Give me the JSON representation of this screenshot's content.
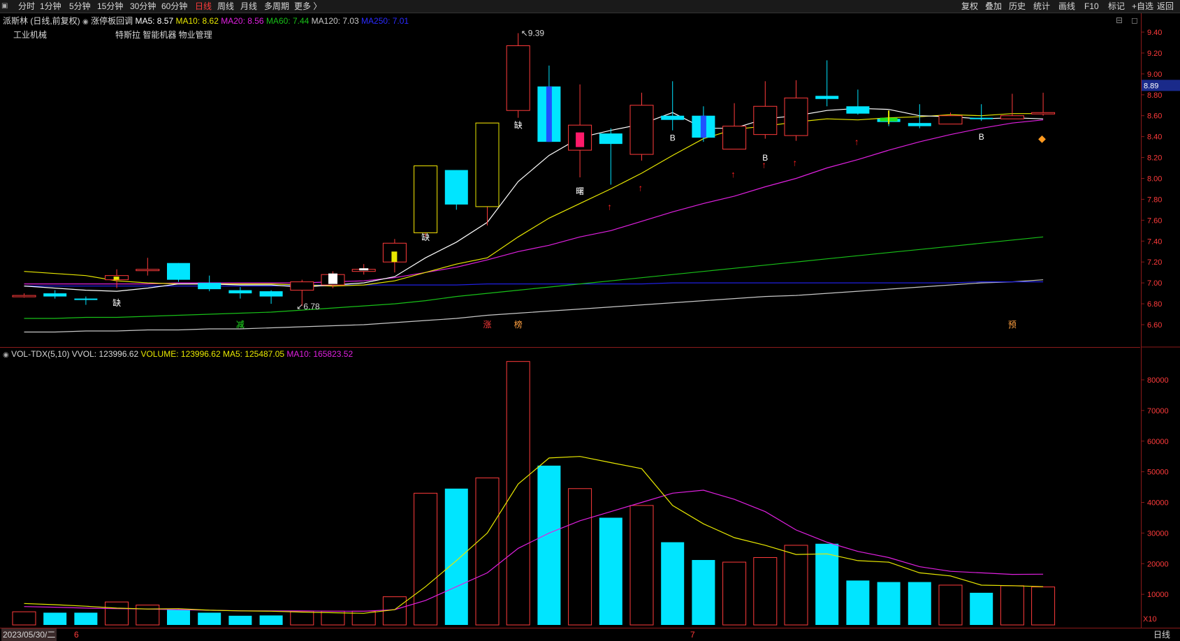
{
  "toolbar": {
    "periods": [
      "分时",
      "1分钟",
      "5分钟",
      "15分钟",
      "30分钟",
      "60分钟",
      "日线",
      "周线",
      "月线",
      "多周期",
      "更多 〉"
    ],
    "active_period": "日线",
    "right_buttons": [
      "复权",
      "叠加",
      "历史",
      "统计",
      "画线",
      "F10",
      "标记",
      "+自选",
      "返回"
    ]
  },
  "main_header": {
    "stock": "派斯林 (日线,前复权)",
    "template": "涨停板回调",
    "ma5": "MA5: 8.57",
    "ma10": "MA10: 8.62",
    "ma20": "MA20: 8.56",
    "ma60": "MA60: 7.44",
    "ma120": "MA120: 7.03",
    "ma250": "MA250: 7.01",
    "industry": "工业机械",
    "concepts": "特斯拉 智能机器 物业管理"
  },
  "colors": {
    "up": "#ff3b3b",
    "down": "#00e5ff",
    "ma5": "#ffffff",
    "ma10": "#e8e800",
    "ma20": "#e020e0",
    "ma60": "#18c018",
    "ma120": "#c8c8c8",
    "ma250": "#2020e0"
  },
  "price_axis": {
    "labels": [
      "9.40",
      "9.20",
      "9.00",
      "8.80",
      "8.60",
      "8.40",
      "8.20",
      "8.00",
      "7.80",
      "7.60",
      "7.40",
      "7.20",
      "7.00",
      "6.80",
      "6.60"
    ],
    "current": "8.89"
  },
  "annotations": {
    "high": "9.39",
    "low": "6.78",
    "gap_label": "缺",
    "dawn_label": "曙",
    "b_label": "B",
    "markers": [
      "减",
      "涨",
      "榜",
      "预"
    ]
  },
  "volume_header": {
    "name": "VOL-TDX(5,10)",
    "vvol": "VVOL: 123996.62",
    "volume": "VOLUME: 123996.62",
    "ma5": "MA5: 125487.05",
    "ma10": "MA10: 165823.52"
  },
  "volume_axis": {
    "labels": [
      "80000",
      "70000",
      "60000",
      "50000",
      "40000",
      "30000",
      "20000",
      "10000"
    ],
    "unit": "X10"
  },
  "date_bar": {
    "date": "2023/05/30/二",
    "month_6": "6",
    "month_7": "7",
    "period": "日线"
  },
  "chart_data": {
    "type": "candlestick",
    "candles": [
      {
        "o": 6.88,
        "c": 6.88,
        "h": 6.9,
        "l": 6.86,
        "up": true
      },
      {
        "o": 6.9,
        "c": 6.87,
        "h": 6.93,
        "l": 6.85,
        "up": false
      },
      {
        "o": 6.85,
        "c": 6.84,
        "h": 6.87,
        "l": 6.79,
        "up": false
      },
      {
        "o": 7.03,
        "c": 7.07,
        "h": 7.13,
        "l": 6.95,
        "up": true
      },
      {
        "o": 7.12,
        "c": 7.13,
        "h": 7.24,
        "l": 7.07,
        "up": true
      },
      {
        "o": 7.19,
        "c": 7.03,
        "h": 7.19,
        "l": 7.01,
        "up": false
      },
      {
        "o": 7.0,
        "c": 6.94,
        "h": 7.07,
        "l": 6.92,
        "up": false
      },
      {
        "o": 6.93,
        "c": 6.9,
        "h": 6.96,
        "l": 6.85,
        "up": false
      },
      {
        "o": 6.92,
        "c": 6.87,
        "h": 6.93,
        "l": 6.8,
        "up": false
      },
      {
        "o": 6.93,
        "c": 7.01,
        "h": 7.03,
        "l": 6.78,
        "up": true
      },
      {
        "o": 6.98,
        "c": 7.08,
        "h": 7.11,
        "l": 6.95,
        "up": true
      },
      {
        "o": 7.11,
        "c": 7.13,
        "h": 7.18,
        "l": 7.08,
        "up": true
      },
      {
        "o": 7.2,
        "c": 7.38,
        "h": 7.42,
        "l": 7.1,
        "up": true
      },
      {
        "o": 7.48,
        "c": 8.12,
        "h": 8.12,
        "l": 7.44,
        "up": true
      },
      {
        "o": 8.08,
        "c": 7.75,
        "h": 8.08,
        "l": 7.7,
        "up": false
      },
      {
        "o": 7.73,
        "c": 8.53,
        "h": 8.53,
        "l": 7.55,
        "up": true
      },
      {
        "o": 8.65,
        "c": 9.27,
        "h": 9.39,
        "l": 8.58,
        "up": true
      },
      {
        "o": 8.88,
        "c": 8.35,
        "h": 9.08,
        "l": 8.35,
        "up": false
      },
      {
        "o": 8.27,
        "c": 8.51,
        "h": 8.9,
        "l": 8.01,
        "up": true
      },
      {
        "o": 8.43,
        "c": 8.33,
        "h": 8.48,
        "l": 7.94,
        "up": false
      },
      {
        "o": 8.23,
        "c": 8.7,
        "h": 8.82,
        "l": 8.17,
        "up": true
      },
      {
        "o": 8.6,
        "c": 8.56,
        "h": 8.93,
        "l": 8.46,
        "up": false
      },
      {
        "o": 8.6,
        "c": 8.39,
        "h": 8.69,
        "l": 8.35,
        "up": false
      },
      {
        "o": 8.28,
        "c": 8.5,
        "h": 8.72,
        "l": 8.28,
        "up": true
      },
      {
        "o": 8.42,
        "c": 8.69,
        "h": 8.93,
        "l": 8.38,
        "up": true
      },
      {
        "o": 8.41,
        "c": 8.77,
        "h": 8.94,
        "l": 8.36,
        "up": true
      },
      {
        "o": 8.79,
        "c": 8.76,
        "h": 9.13,
        "l": 8.69,
        "up": false
      },
      {
        "o": 8.69,
        "c": 8.62,
        "h": 8.85,
        "l": 8.61,
        "up": false
      },
      {
        "o": 8.54,
        "c": 8.57,
        "h": 8.64,
        "l": 8.5,
        "up": false
      },
      {
        "o": 8.53,
        "c": 8.5,
        "h": 8.71,
        "l": 8.48,
        "up": false
      },
      {
        "o": 8.52,
        "c": 8.6,
        "h": 8.63,
        "l": 8.52,
        "up": true
      },
      {
        "o": 8.58,
        "c": 8.57,
        "h": 8.71,
        "l": 8.55,
        "up": false
      },
      {
        "o": 8.57,
        "c": 8.6,
        "h": 8.81,
        "l": 8.57,
        "up": true
      },
      {
        "o": 8.62,
        "c": 8.63,
        "h": 8.82,
        "l": 8.6,
        "up": true
      }
    ],
    "ma5": [
      6.97,
      6.95,
      6.93,
      6.92,
      6.95,
      6.99,
      6.99,
      6.98,
      6.98,
      6.96,
      6.98,
      7.0,
      7.06,
      7.24,
      7.39,
      7.58,
      7.97,
      8.22,
      8.39,
      8.46,
      8.52,
      8.63,
      8.48,
      8.48,
      8.57,
      8.6,
      8.65,
      8.67,
      8.66,
      8.6,
      8.59,
      8.57,
      8.58,
      8.57
    ],
    "ma10": [
      7.11,
      7.09,
      7.07,
      7.02,
      7.0,
      6.99,
      6.99,
      6.99,
      6.99,
      6.98,
      6.97,
      6.98,
      7.02,
      7.1,
      7.18,
      7.24,
      7.44,
      7.62,
      7.76,
      7.9,
      8.05,
      8.22,
      8.38,
      8.47,
      8.5,
      8.54,
      8.57,
      8.56,
      8.58,
      8.59,
      8.61,
      8.6,
      8.62,
      8.62
    ],
    "ma20": [
      6.99,
      6.99,
      6.99,
      6.99,
      6.99,
      7.0,
      7.0,
      7.0,
      7.0,
      7.0,
      7.01,
      7.02,
      7.05,
      7.1,
      7.15,
      7.22,
      7.3,
      7.36,
      7.44,
      7.5,
      7.59,
      7.68,
      7.76,
      7.83,
      7.92,
      8.0,
      8.1,
      8.18,
      8.27,
      8.35,
      8.42,
      8.48,
      8.53,
      8.56
    ],
    "ma60": [
      6.66,
      6.66,
      6.67,
      6.67,
      6.68,
      6.69,
      6.7,
      6.71,
      6.72,
      6.74,
      6.76,
      6.78,
      6.8,
      6.83,
      6.87,
      6.9,
      6.93,
      6.96,
      6.99,
      7.02,
      7.05,
      7.08,
      7.11,
      7.14,
      7.17,
      7.2,
      7.23,
      7.26,
      7.29,
      7.32,
      7.35,
      7.38,
      7.41,
      7.44
    ],
    "ma120": [
      6.53,
      6.53,
      6.54,
      6.54,
      6.55,
      6.55,
      6.56,
      6.56,
      6.57,
      6.58,
      6.59,
      6.6,
      6.62,
      6.64,
      6.66,
      6.69,
      6.71,
      6.73,
      6.75,
      6.77,
      6.79,
      6.81,
      6.83,
      6.85,
      6.87,
      6.88,
      6.9,
      6.92,
      6.94,
      6.96,
      6.98,
      7.0,
      7.01,
      7.03
    ],
    "ma250": [
      6.97,
      6.97,
      6.97,
      6.97,
      6.97,
      6.97,
      6.97,
      6.97,
      6.97,
      6.98,
      6.98,
      6.98,
      6.98,
      6.98,
      6.98,
      6.99,
      6.99,
      6.99,
      6.99,
      6.99,
      6.99,
      7.0,
      7.0,
      7.0,
      7.0,
      7.0,
      7.0,
      7.0,
      7.0,
      7.0,
      7.0,
      7.01,
      7.01,
      7.01
    ],
    "volume": [
      4300,
      4000,
      4000,
      7500,
      6500,
      5000,
      4000,
      3000,
      3100,
      4500,
      4500,
      4500,
      9200,
      43000,
      44500,
      48000,
      86000,
      52000,
      44500,
      35000,
      39000,
      27000,
      21200,
      20500,
      22000,
      26000,
      26500,
      14500,
      14000,
      14000,
      13000,
      10500,
      12800,
      12400
    ],
    "vol_ma5": [
      7000,
      6600,
      6100,
      5500,
      5200,
      5300,
      4800,
      4600,
      4500,
      4200,
      4000,
      3800,
      5000,
      12500,
      21000,
      30000,
      46000,
      54500,
      55000,
      53000,
      51000,
      39000,
      33000,
      28500,
      26000,
      23000,
      23200,
      21000,
      20500,
      17000,
      16000,
      13000,
      12800,
      12500
    ],
    "vol_ma10": [
      6000,
      5800,
      5500,
      5300,
      5200,
      5000,
      4800,
      4600,
      4600,
      4600,
      4500,
      4500,
      5000,
      8000,
      12500,
      17000,
      25000,
      30000,
      34000,
      37000,
      40000,
      43000,
      44000,
      41000,
      37000,
      31000,
      27000,
      24000,
      22000,
      19000,
      17500,
      17000,
      16500,
      16580
    ],
    "ylim_price": [
      6.5,
      9.48
    ],
    "ylim_vol": [
      0,
      86000
    ]
  }
}
